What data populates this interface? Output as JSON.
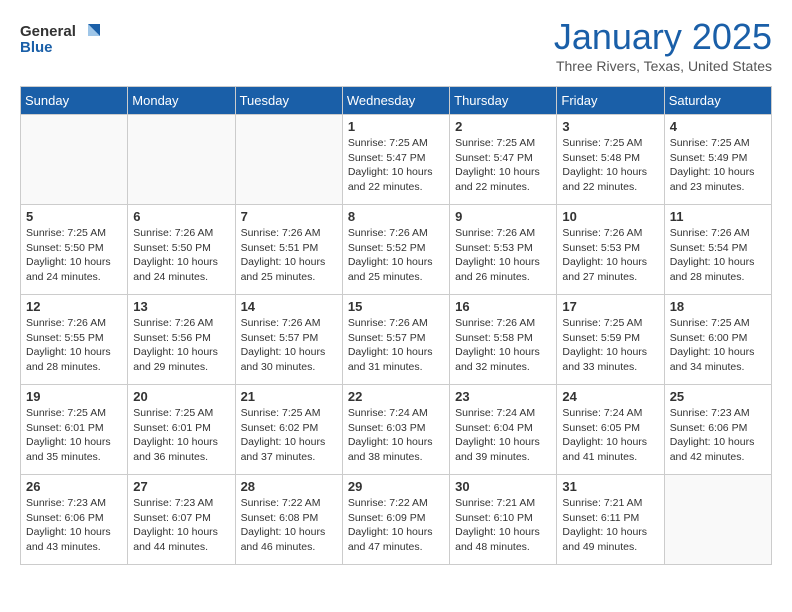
{
  "header": {
    "logo_general": "General",
    "logo_blue": "Blue",
    "month": "January 2025",
    "location": "Three Rivers, Texas, United States"
  },
  "weekdays": [
    "Sunday",
    "Monday",
    "Tuesday",
    "Wednesday",
    "Thursday",
    "Friday",
    "Saturday"
  ],
  "weeks": [
    [
      {
        "day": "",
        "empty": true
      },
      {
        "day": "",
        "empty": true
      },
      {
        "day": "",
        "empty": true
      },
      {
        "day": "1",
        "sunrise": "7:25 AM",
        "sunset": "5:47 PM",
        "daylight": "10 hours and 22 minutes."
      },
      {
        "day": "2",
        "sunrise": "7:25 AM",
        "sunset": "5:47 PM",
        "daylight": "10 hours and 22 minutes."
      },
      {
        "day": "3",
        "sunrise": "7:25 AM",
        "sunset": "5:48 PM",
        "daylight": "10 hours and 22 minutes."
      },
      {
        "day": "4",
        "sunrise": "7:25 AM",
        "sunset": "5:49 PM",
        "daylight": "10 hours and 23 minutes."
      }
    ],
    [
      {
        "day": "5",
        "sunrise": "7:25 AM",
        "sunset": "5:50 PM",
        "daylight": "10 hours and 24 minutes."
      },
      {
        "day": "6",
        "sunrise": "7:26 AM",
        "sunset": "5:50 PM",
        "daylight": "10 hours and 24 minutes."
      },
      {
        "day": "7",
        "sunrise": "7:26 AM",
        "sunset": "5:51 PM",
        "daylight": "10 hours and 25 minutes."
      },
      {
        "day": "8",
        "sunrise": "7:26 AM",
        "sunset": "5:52 PM",
        "daylight": "10 hours and 25 minutes."
      },
      {
        "day": "9",
        "sunrise": "7:26 AM",
        "sunset": "5:53 PM",
        "daylight": "10 hours and 26 minutes."
      },
      {
        "day": "10",
        "sunrise": "7:26 AM",
        "sunset": "5:53 PM",
        "daylight": "10 hours and 27 minutes."
      },
      {
        "day": "11",
        "sunrise": "7:26 AM",
        "sunset": "5:54 PM",
        "daylight": "10 hours and 28 minutes."
      }
    ],
    [
      {
        "day": "12",
        "sunrise": "7:26 AM",
        "sunset": "5:55 PM",
        "daylight": "10 hours and 28 minutes."
      },
      {
        "day": "13",
        "sunrise": "7:26 AM",
        "sunset": "5:56 PM",
        "daylight": "10 hours and 29 minutes."
      },
      {
        "day": "14",
        "sunrise": "7:26 AM",
        "sunset": "5:57 PM",
        "daylight": "10 hours and 30 minutes."
      },
      {
        "day": "15",
        "sunrise": "7:26 AM",
        "sunset": "5:57 PM",
        "daylight": "10 hours and 31 minutes."
      },
      {
        "day": "16",
        "sunrise": "7:26 AM",
        "sunset": "5:58 PM",
        "daylight": "10 hours and 32 minutes."
      },
      {
        "day": "17",
        "sunrise": "7:25 AM",
        "sunset": "5:59 PM",
        "daylight": "10 hours and 33 minutes."
      },
      {
        "day": "18",
        "sunrise": "7:25 AM",
        "sunset": "6:00 PM",
        "daylight": "10 hours and 34 minutes."
      }
    ],
    [
      {
        "day": "19",
        "sunrise": "7:25 AM",
        "sunset": "6:01 PM",
        "daylight": "10 hours and 35 minutes."
      },
      {
        "day": "20",
        "sunrise": "7:25 AM",
        "sunset": "6:01 PM",
        "daylight": "10 hours and 36 minutes."
      },
      {
        "day": "21",
        "sunrise": "7:25 AM",
        "sunset": "6:02 PM",
        "daylight": "10 hours and 37 minutes."
      },
      {
        "day": "22",
        "sunrise": "7:24 AM",
        "sunset": "6:03 PM",
        "daylight": "10 hours and 38 minutes."
      },
      {
        "day": "23",
        "sunrise": "7:24 AM",
        "sunset": "6:04 PM",
        "daylight": "10 hours and 39 minutes."
      },
      {
        "day": "24",
        "sunrise": "7:24 AM",
        "sunset": "6:05 PM",
        "daylight": "10 hours and 41 minutes."
      },
      {
        "day": "25",
        "sunrise": "7:23 AM",
        "sunset": "6:06 PM",
        "daylight": "10 hours and 42 minutes."
      }
    ],
    [
      {
        "day": "26",
        "sunrise": "7:23 AM",
        "sunset": "6:06 PM",
        "daylight": "10 hours and 43 minutes."
      },
      {
        "day": "27",
        "sunrise": "7:23 AM",
        "sunset": "6:07 PM",
        "daylight": "10 hours and 44 minutes."
      },
      {
        "day": "28",
        "sunrise": "7:22 AM",
        "sunset": "6:08 PM",
        "daylight": "10 hours and 46 minutes."
      },
      {
        "day": "29",
        "sunrise": "7:22 AM",
        "sunset": "6:09 PM",
        "daylight": "10 hours and 47 minutes."
      },
      {
        "day": "30",
        "sunrise": "7:21 AM",
        "sunset": "6:10 PM",
        "daylight": "10 hours and 48 minutes."
      },
      {
        "day": "31",
        "sunrise": "7:21 AM",
        "sunset": "6:11 PM",
        "daylight": "10 hours and 49 minutes."
      },
      {
        "day": "",
        "empty": true
      }
    ]
  ],
  "labels": {
    "sunrise": "Sunrise:",
    "sunset": "Sunset:",
    "daylight": "Daylight:"
  }
}
